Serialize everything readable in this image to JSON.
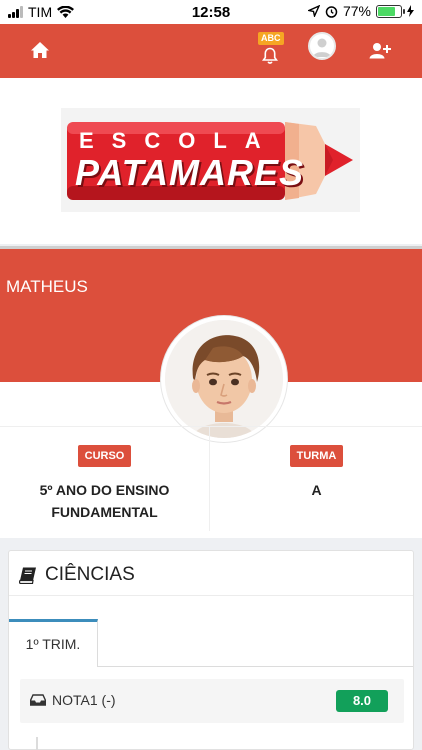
{
  "status_bar": {
    "carrier": "TIM",
    "time": "12:58",
    "battery": "77%"
  },
  "app_bar": {
    "home_icon": "home-icon",
    "notification_badge": "ABC",
    "bell_icon": "bell-icon",
    "avatar_icon": "user-avatar-icon",
    "add_user_icon": "user-plus-icon",
    "color": "#dc4f3c"
  },
  "logo": {
    "line1": "ESCOLA",
    "line2": "PATAMARES"
  },
  "profile": {
    "name": "MATHEUS",
    "course_label": "CURSO",
    "course_value": "5º ANO DO ENSINO FUNDAMENTAL",
    "class_label": "TURMA",
    "class_value": "A"
  },
  "subject": {
    "icon": "book-icon",
    "title": "CIÊNCIAS",
    "tabs": [
      {
        "label": "1º TRIM.",
        "active": true
      }
    ],
    "grades": [
      {
        "icon": "inbox-icon",
        "label": "NOTA1 (-)",
        "value": "8.0",
        "color": "#12a05a"
      }
    ]
  }
}
